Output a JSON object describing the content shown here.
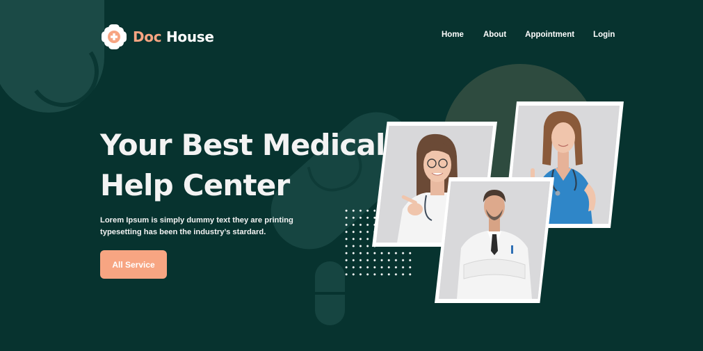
{
  "brand": {
    "name_part1": "Doc",
    "name_part2": "House",
    "icon": "medical-cross-icon"
  },
  "nav": {
    "items": [
      {
        "label": "Home"
      },
      {
        "label": "About"
      },
      {
        "label": "Appointment"
      },
      {
        "label": "Login"
      }
    ]
  },
  "hero": {
    "headline_line1": "Your Best Medical",
    "headline_line2": "Help Center",
    "subtext": "Lorem Ipsum is simply dummy text they are printing typesetting has been the industry’s stardard.",
    "cta_label": "All Service"
  },
  "colors": {
    "background": "#07332F",
    "accent": "#F7A582",
    "text": "#F3F3F3",
    "decor": "#164541"
  }
}
